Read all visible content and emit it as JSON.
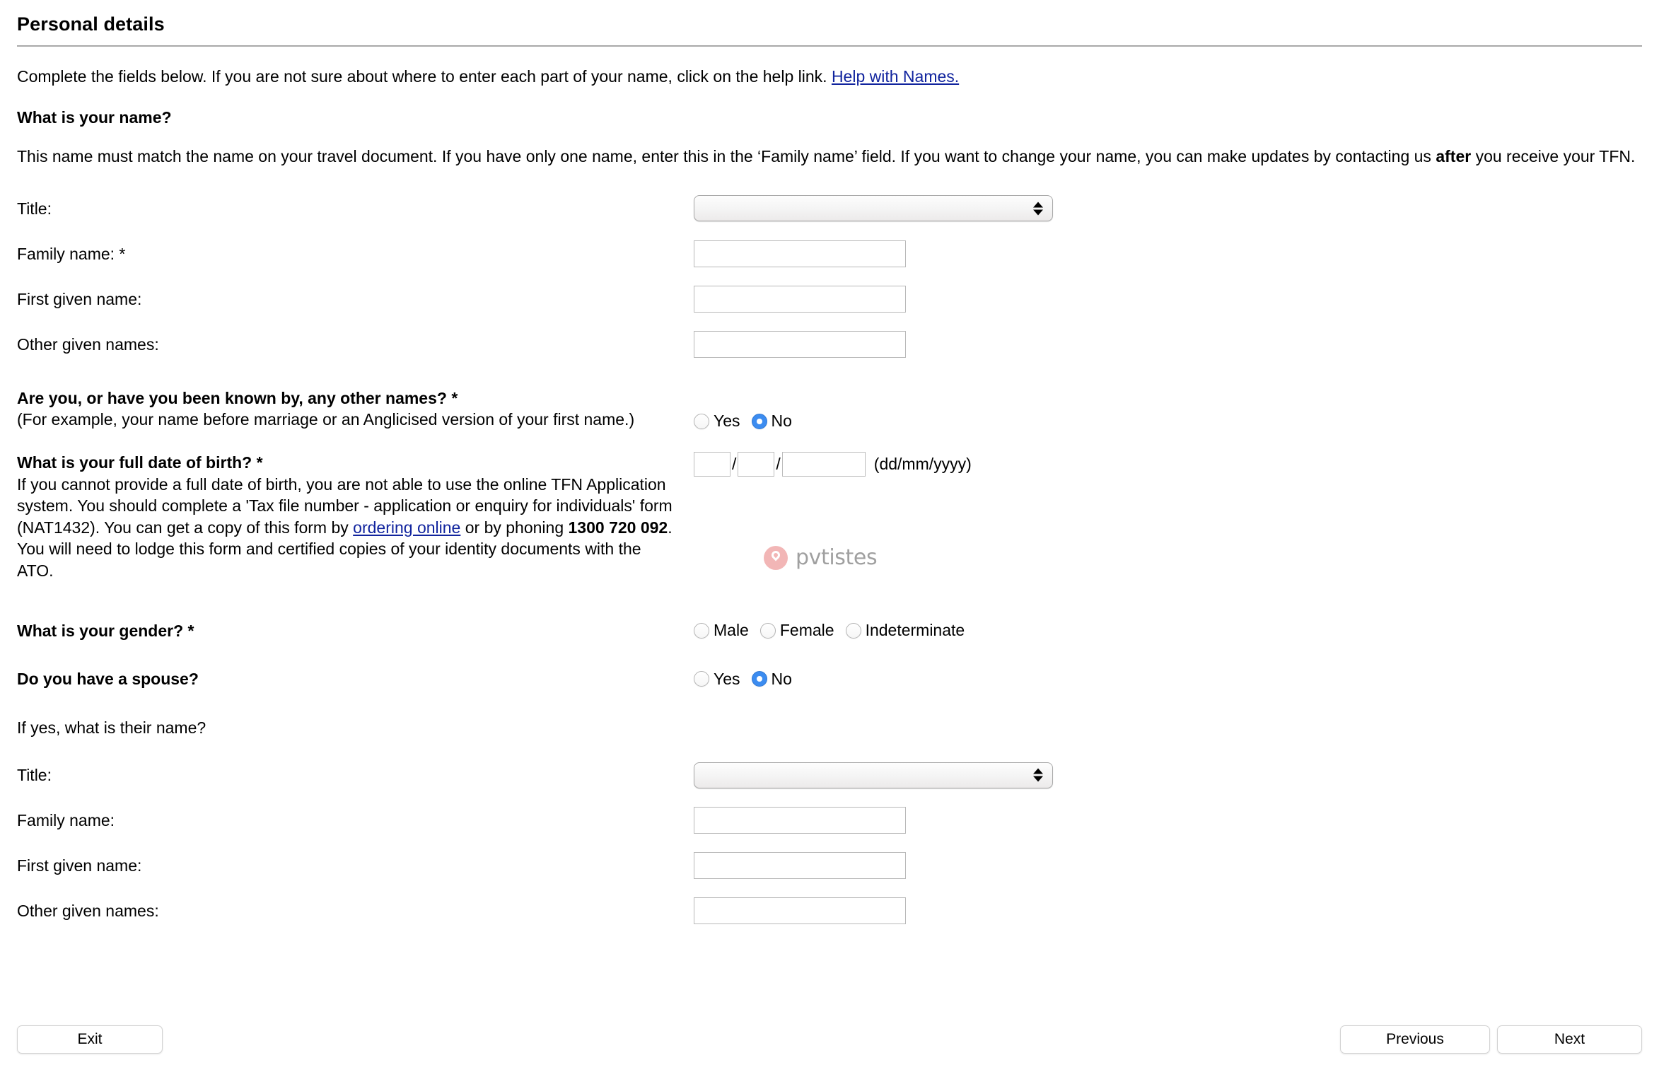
{
  "header": {
    "title": "Personal details"
  },
  "intro": {
    "text": "Complete the fields below. If you are not sure about where to enter each part of your name, click on the help link. ",
    "link_label": "Help with Names."
  },
  "name_section": {
    "heading": "What is your name?",
    "description_part1": "This name must match the name on your travel document. If you have only one name, enter this in the ‘Family name’ field. If you want to change your name, you can make updates by contacting us ",
    "description_bold": "after",
    "description_part2": " you receive your TFN.",
    "fields": {
      "title_label": "Title:",
      "title_value": "",
      "title_options": [
        ""
      ],
      "family_label": "Family name: *",
      "family_value": "",
      "first_given_label": "First given name:",
      "first_given_value": "",
      "other_given_label": "Other given names:",
      "other_given_value": ""
    }
  },
  "other_names": {
    "question": "Are you, or have you been known by, any other names? *",
    "sub": "(For example, your name before marriage or an Anglicised version of your first name.)",
    "options": [
      {
        "label": "Yes",
        "selected": false
      },
      {
        "label": "No",
        "selected": true
      }
    ]
  },
  "dob": {
    "question": "What is your full date of birth? *",
    "help_part1": "If you cannot provide a full date of birth, you are not able to use the online TFN Application system. You should complete a 'Tax file number - application or enquiry for individuals' form (NAT1432). You can get a copy of this form by ",
    "help_link": "ordering online",
    "help_part2": " or by phoning ",
    "help_phone": "1300 720 092",
    "help_part3": ". You will need to lodge this form and certified copies of your identity documents with the ATO.",
    "day_value": "",
    "month_value": "",
    "year_value": "",
    "separator": "/",
    "format_hint": "(dd/mm/yyyy)"
  },
  "gender": {
    "question": "What is your gender? *",
    "options": [
      {
        "label": "Male",
        "selected": false
      },
      {
        "label": "Female",
        "selected": false
      },
      {
        "label": "Indeterminate",
        "selected": false
      }
    ]
  },
  "spouse": {
    "question": "Do you have a spouse?",
    "options": [
      {
        "label": "Yes",
        "selected": false
      },
      {
        "label": "No",
        "selected": true
      }
    ],
    "sub_prompt": "If yes, what is their name?",
    "fields": {
      "title_label": "Title:",
      "title_value": "",
      "title_options": [
        ""
      ],
      "family_label": "Family name:",
      "family_value": "",
      "first_given_label": "First given name:",
      "first_given_value": "",
      "other_given_label": "Other given names:",
      "other_given_value": ""
    }
  },
  "watermark": {
    "text": "pvtistes"
  },
  "footer": {
    "exit_label": "Exit",
    "previous_label": "Previous",
    "next_label": "Next"
  },
  "colors": {
    "link": "#11249e",
    "radio_selected": "#3c8cf0",
    "rule": "#a9a9a9",
    "watermark_logo": "#f2b3b3",
    "watermark_text": "#9b9b9b"
  }
}
